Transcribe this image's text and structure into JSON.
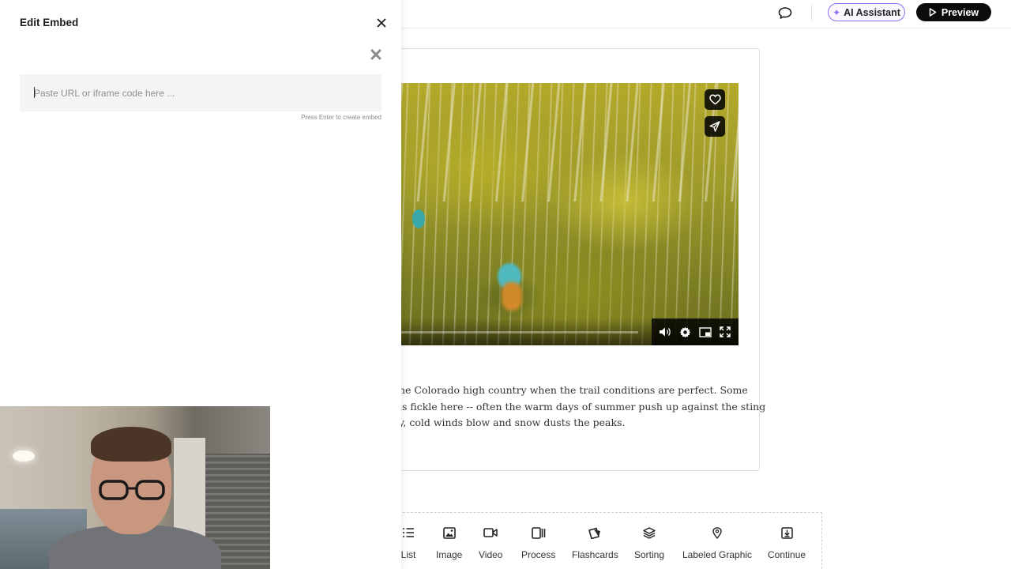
{
  "topbar": {
    "ai_assistant_label": "AI Assistant",
    "preview_label": "Preview",
    "icons": {
      "comment": "chat-bubble-icon",
      "ai": "sparkle-icon",
      "preview": "play-icon"
    }
  },
  "lesson": {
    "video": {
      "progress": 0.0,
      "actions": [
        "heart-icon",
        "send-icon"
      ],
      "controls": [
        "volume-icon",
        "gear-icon",
        "picture-in-picture-icon",
        "fullscreen-icon"
      ]
    },
    "paragraph_lines": [
      "he Colorado high country when the trail conditions are perfect. Some",
      "is fickle here -- often the warm days of summer push up against the sting",
      "y, cold winds blow and snow dusts the peaks."
    ]
  },
  "block_toolbar": {
    "items": [
      {
        "label": "List",
        "icon": "list-icon"
      },
      {
        "label": "Image",
        "icon": "image-icon"
      },
      {
        "label": "Video",
        "icon": "video-icon"
      },
      {
        "label": "Process",
        "icon": "process-icon"
      },
      {
        "label": "Flashcards",
        "icon": "flashcards-icon"
      },
      {
        "label": "Sorting",
        "icon": "layers-icon"
      },
      {
        "label": "Labeled Graphic",
        "icon": "map-pin-icon"
      },
      {
        "label": "Continue",
        "icon": "continue-icon"
      }
    ]
  },
  "embed_panel": {
    "title": "Edit Embed",
    "input": {
      "value": "",
      "placeholder": "Paste URL or iframe code here ..."
    },
    "hint": "Press Enter to create embed",
    "icons": {
      "close": "close-icon",
      "clear": "clear-x-icon"
    }
  },
  "colors": {
    "accent_purple": "#8e6ff2",
    "preview_bg": "#0b0b0b",
    "panel_input_bg": "#f4f4f4"
  }
}
